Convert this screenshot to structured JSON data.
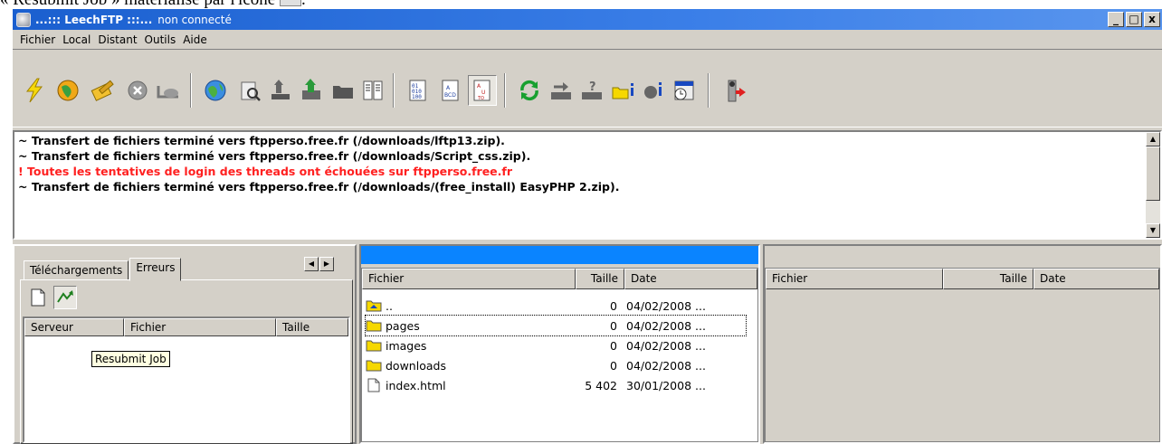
{
  "caption": "« Resubmit Job » matérialisé par l'icône",
  "window": {
    "app_title": "...::: LeechFTP :::...",
    "status": "non connecté",
    "controls": {
      "minimize": "_",
      "maximize": "□",
      "close": "x"
    }
  },
  "menu": [
    "Fichier",
    "Local",
    "Distant",
    "Outils",
    "Aide"
  ],
  "toolbar": {
    "icons": [
      "lightning-icon",
      "globe-icon",
      "bookmark-pencil-icon",
      "disconnect-icon",
      "snail-icon",
      "world-icon",
      "find-icon",
      "upload-tray-icon",
      "upload-folder-icon",
      "folder-icon",
      "split-file-icon",
      "binary-mode-icon",
      "ascii-mode-icon",
      "auto-mode-icon",
      "refresh-icon",
      "move-icon",
      "query-icon",
      "new-folder-icon",
      "info-icon",
      "schedule-icon",
      "exit-icon"
    ],
    "pressed_icon": "auto-mode-icon"
  },
  "log": {
    "lines": [
      {
        "text": "~ Transfert de fichiers terminé vers ftpperso.free.fr (/downloads/lftp13.zip).",
        "error": false
      },
      {
        "text": "~ Transfert de fichiers terminé vers ftpperso.free.fr (/downloads/Script_css.zip).",
        "error": false
      },
      {
        "text": "! Toutes les tentatives de login des threads ont échouées sur ftpperso.free.fr",
        "error": true
      },
      {
        "text": "~ Transfert de fichiers terminé vers ftpperso.free.fr (/downloads/(free_install) EasyPHP 2.zip).",
        "error": false
      }
    ],
    "error_color": "#ff2020"
  },
  "queue": {
    "tabs": [
      "Téléchargements",
      "Erreurs"
    ],
    "active_tab": "Erreurs",
    "columns": [
      "Serveur",
      "Fichier",
      "Taille"
    ],
    "tooltip": "Resubmit Job"
  },
  "local": {
    "columns": [
      "Fichier",
      "Taille",
      "Date"
    ],
    "rows": [
      {
        "name": "..",
        "size": "0",
        "date": "04/02/2008 ...",
        "type": "parent"
      },
      {
        "name": "pages",
        "size": "0",
        "date": "04/02/2008 ...",
        "type": "folder"
      },
      {
        "name": "images",
        "size": "0",
        "date": "04/02/2008 ...",
        "type": "folder"
      },
      {
        "name": "downloads",
        "size": "0",
        "date": "04/02/2008 ...",
        "type": "folder"
      },
      {
        "name": "index.html",
        "size": "5 402",
        "date": "30/01/2008 ...",
        "type": "file"
      }
    ],
    "header_bar_color": "#0a84ff"
  },
  "remote": {
    "columns": [
      "Fichier",
      "Taille",
      "Date"
    ]
  }
}
